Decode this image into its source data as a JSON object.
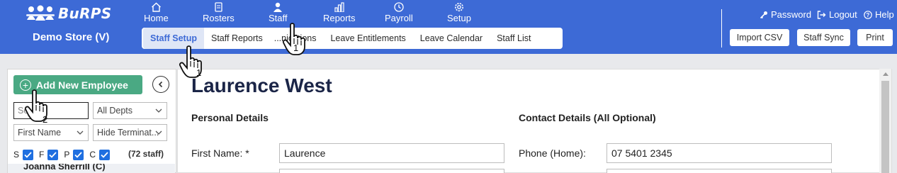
{
  "brand": {
    "name": "BuRPS",
    "store": "Demo Store (V)"
  },
  "nav": {
    "home": "Home",
    "rosters": "Rosters",
    "staff": "Staff",
    "reports": "Reports",
    "payroll": "Payroll",
    "setup": "Setup"
  },
  "subnav": {
    "tabs": [
      {
        "label": "Staff Setup",
        "active": true
      },
      {
        "label": "Staff Reports"
      },
      {
        "label": "...nications"
      },
      {
        "label": "Leave Entitlements"
      },
      {
        "label": "Leave Calendar"
      },
      {
        "label": "Staff List"
      }
    ]
  },
  "toplinks": {
    "password": "Password",
    "logout": "Logout",
    "help": "Help"
  },
  "header_buttons": {
    "import": "Import CSV",
    "sync": "Staff Sync",
    "print": "Print"
  },
  "sidebar": {
    "add_button": "Add New Employee",
    "search_placeholder": "Se",
    "dept_select": "All Depts",
    "sort_select": "First Name",
    "terminated_select": "Hide Terminat...",
    "filters": {
      "s": "S",
      "f": "F",
      "p": "P",
      "c": "C"
    },
    "staff_count": "(72 staff)",
    "first_employee": "Joanna Sherrill (C)"
  },
  "employee": {
    "name": "Laurence West",
    "personal_heading": "Personal Details",
    "contact_heading": "Contact Details (All Optional)",
    "first_name_label": "First Name: *",
    "first_name_value": "Laurence",
    "phone_home_label": "Phone (Home):",
    "phone_home_value": "07 5401 2345"
  },
  "cursors": {
    "staff": "1",
    "staff_setup": "1",
    "search": "2"
  },
  "colors": {
    "header": "#3d6ad6",
    "add_button": "#4aa983",
    "checkbox": "#1f6fe0",
    "title": "#1b2547"
  }
}
